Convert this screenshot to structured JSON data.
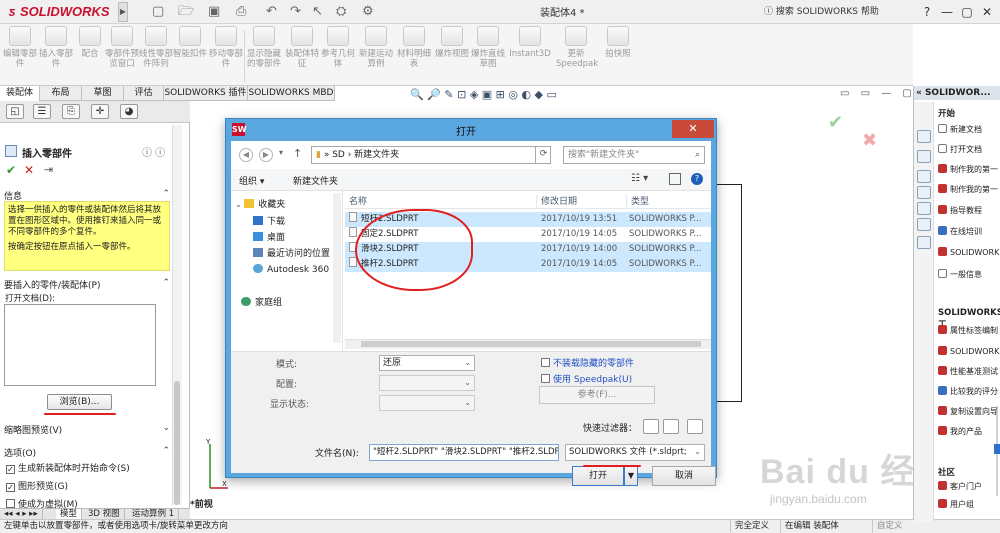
{
  "app": {
    "logo_text": "SOLIDWORKS",
    "doc_title": "装配体4 *",
    "help_search": "搜索 SOLIDWORKS 帮助",
    "window_buttons": [
      "?",
      "—",
      "▢",
      "✕"
    ]
  },
  "command_manager": {
    "commands": [
      "编辑零部件",
      "插入零部件",
      "配合",
      "零部件预览窗口",
      "线性零部件阵列",
      "智能扣件",
      "移动零部件",
      "显示隐藏的零部件",
      "装配体特征",
      "参考几何体",
      "新建运动算例",
      "材料明细表",
      "爆炸视图",
      "爆炸直线草图",
      "Instant3D",
      "更新Speedpak",
      "拍快照"
    ]
  },
  "tabs": [
    "装配体",
    "布局",
    "草图",
    "评估",
    "SOLIDWORKS 插件",
    "SOLIDWORKS MBD"
  ],
  "property_manager": {
    "title": "插入零部件",
    "info_header": "信息",
    "info_text": "选择一供插入的零件或装配体然后将其放置在图形区域中。使用推钉来插入同一或不同零部件的多个复件。",
    "info_text2": "按确定按钮在原点插入一零部件。",
    "group_insert": "要插入的零件/装配体(P)",
    "open_docs_label": "打开文档(D):",
    "browse_label": "浏览(B)...",
    "group_thumb": "缩略图预览(V)",
    "group_options": "选项(O)",
    "opt1": "生成新装配体时开始命令(S)",
    "opt2": "图形预览(G)",
    "opt3": "使成为虚拟(M)"
  },
  "bottom_tabs": [
    "模型",
    "3D 视图",
    "运动算例 1"
  ],
  "status": {
    "hint": "左键单击以放置零部件，或者使用选项卡/旋转菜单更改方向",
    "cell1": "完全定义",
    "cell2": "在编辑 装配体",
    "cell3": "自定义"
  },
  "graphics": {
    "view_label": "*前视",
    "watermark": "Bai du 经验",
    "watermark_url": "jingyan.baidu.com"
  },
  "task_pane": {
    "header": "SOLIDWOR...",
    "section1": "开始",
    "items1": [
      "新建文档",
      "打开文档",
      "制作我的第一",
      "制作我的第一",
      "指导教程",
      "在线培训",
      "SOLIDWORK",
      "一般信息"
    ],
    "section2": "SOLIDWORKS 工",
    "items2": [
      "属性标签编制",
      "SOLIDWORK",
      "性能基准测试",
      "比较我的评分",
      "复制设置向导",
      "我的产品"
    ],
    "section3": "社区",
    "items3": [
      "客户门户",
      "用户组"
    ]
  },
  "dialog": {
    "title": "打开",
    "breadcrumb": [
      "SD",
      "新建文件夹"
    ],
    "search_placeholder": "搜索\"新建文件夹\"",
    "organize": "组织 ▾",
    "new_folder": "新建文件夹",
    "nav": [
      "收藏夹",
      "下载",
      "桌面",
      "最近访问的位置",
      "Autodesk 360",
      "家庭组"
    ],
    "columns": [
      "名称",
      "修改日期",
      "类型"
    ],
    "files": [
      {
        "name": "短杆2.SLDPRT",
        "date": "2017/10/19 13:51",
        "type": "SOLIDWORKS P...",
        "selected": true
      },
      {
        "name": "固定2.SLDPRT",
        "date": "2017/10/19 14:05",
        "type": "SOLIDWORKS P...",
        "selected": false
      },
      {
        "name": "滑块2.SLDPRT",
        "date": "2017/10/19 14:00",
        "type": "SOLIDWORKS P...",
        "selected": true
      },
      {
        "name": "推杆2.SLDPRT",
        "date": "2017/10/19 14:05",
        "type": "SOLIDWORKS P...",
        "selected": true
      }
    ],
    "mode_label": "模式:",
    "mode_value": "还原",
    "config_label": "配置:",
    "display_label": "显示状态:",
    "chk_hidden": "不装载隐藏的零部件",
    "chk_speedpak": "使用 Speedpak(U)",
    "ref_button": "参考(F)...",
    "quick_filter": "快速过滤器：",
    "filename_label": "文件名(N):",
    "filename_value": "\"短杆2.SLDPRT\" \"滑块2.SLDPRT\" \"推杆2.SLDPRT\"",
    "filetype_value": "SOLIDWORKS 文件 (*.sldprt;",
    "open_button": "打开",
    "cancel_button": "取消"
  }
}
